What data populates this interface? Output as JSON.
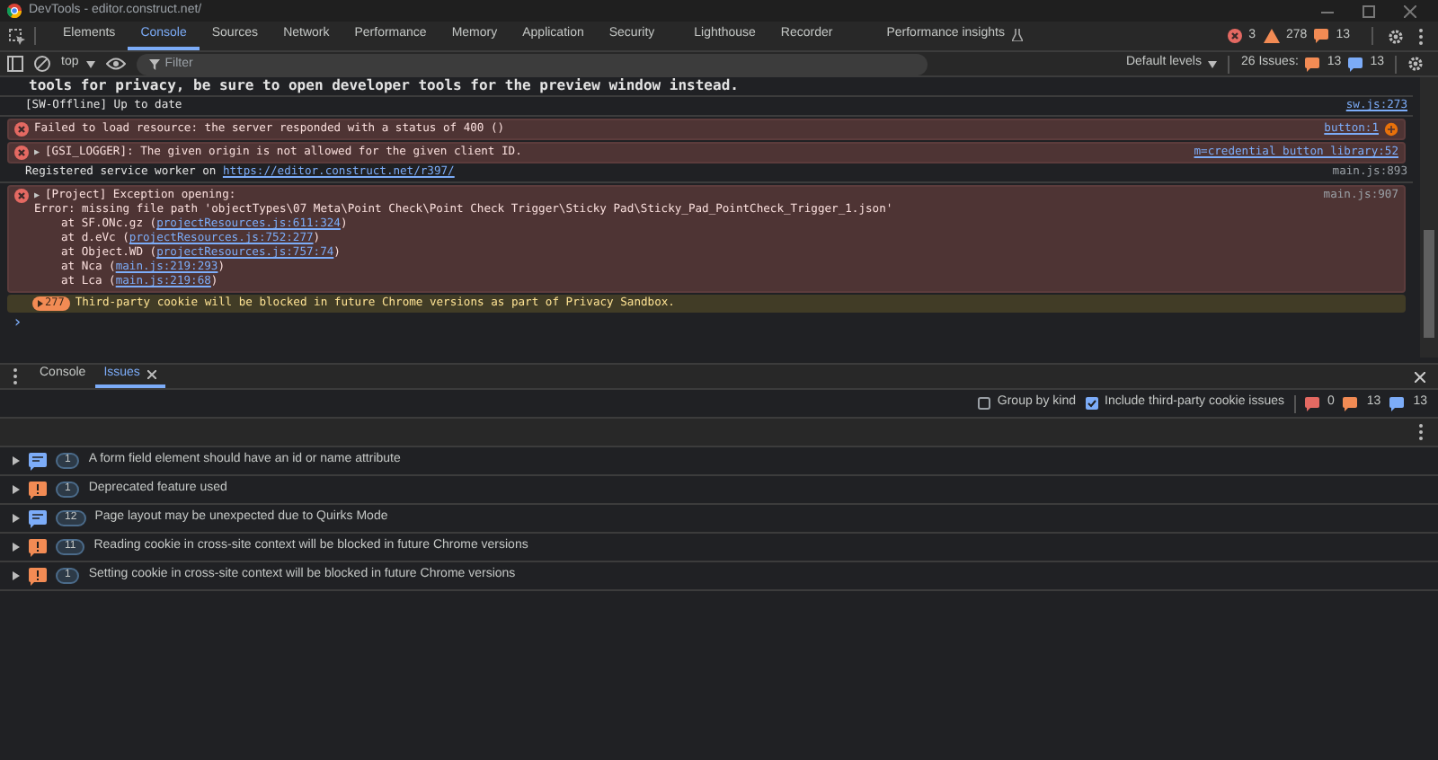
{
  "window": {
    "title": "DevTools - editor.construct.net/"
  },
  "tabs": [
    {
      "label": "Elements",
      "selected": false
    },
    {
      "label": "Console",
      "selected": true
    },
    {
      "label": "Sources",
      "selected": false
    },
    {
      "label": "Network",
      "selected": false
    },
    {
      "label": "Performance",
      "selected": false
    },
    {
      "label": "Memory",
      "selected": false
    },
    {
      "label": "Application",
      "selected": false
    },
    {
      "label": "Security",
      "selected": false
    },
    {
      "label": "Lighthouse",
      "selected": false
    },
    {
      "label": "Recorder",
      "selected": false
    },
    {
      "label": "Performance insights",
      "selected": false
    }
  ],
  "counters": {
    "errors": "3",
    "warnings": "278",
    "issues": "13"
  },
  "toolbar": {
    "context": "top",
    "filter_placeholder": "Filter",
    "levels": "Default levels",
    "issues_label": "26 Issues:",
    "issues_warning": "13",
    "issues_info": "13"
  },
  "console": {
    "clipped_line": "tools for privacy, be sure to open developer tools for the preview window instead.",
    "messages": [
      {
        "kind": "info",
        "text": "[SW-Offline] Up to date",
        "source": "sw.js:273",
        "source_link": true
      },
      {
        "kind": "error",
        "text": "Failed to load resource: the server responded with a status of 400 ()",
        "source": "button:1",
        "source_link": true
      },
      {
        "kind": "error",
        "toggle": "▶",
        "text": "[GSI_LOGGER]: The given origin is not allowed for the given client ID.",
        "source": "m=credential_button_library:52",
        "source_link": true
      },
      {
        "kind": "info",
        "text": "Registered service worker on ",
        "link": "https://editor.construct.net/r397/",
        "source": "main.js:893",
        "source_link": false
      },
      {
        "kind": "error",
        "toggle": "▶",
        "text": "[Project] Exception opening:",
        "source": "main.js:907",
        "source_link": false,
        "detail": "Error: missing file path 'objectTypes\\07 Meta\\Point Check\\Point Check Trigger\\Sticky Pad\\Sticky_Pad_PointCheck_Trigger_1.json'",
        "stack": [
          {
            "prefix": "at SF.ONc.gz (",
            "link": "projectResources.js:611:324",
            "suffix": ")"
          },
          {
            "prefix": "at d.eVc (",
            "link": "projectResources.js:752:277",
            "suffix": ")"
          },
          {
            "prefix": "at Object.WD (",
            "link": "projectResources.js:757:74",
            "suffix": ")"
          },
          {
            "prefix": "at Nca (",
            "link": "main.js:219:293",
            "suffix": ")"
          },
          {
            "prefix": "at Lca (",
            "link": "main.js:219:68",
            "suffix": ")"
          }
        ]
      },
      {
        "kind": "warning",
        "badge": "277",
        "text": "Third-party cookie will be blocked in future Chrome versions as part of Privacy Sandbox."
      }
    ],
    "prompt": "›"
  },
  "drawer": {
    "tabs": [
      {
        "label": "Console",
        "selected": false
      },
      {
        "label": "Issues",
        "selected": true
      }
    ],
    "group_by_kind": {
      "label": "Group by kind",
      "checked": false
    },
    "third_party": {
      "label": "Include third-party cookie issues",
      "checked": true
    },
    "counts": {
      "errors": "0",
      "warnings": "13",
      "info": "13"
    },
    "issues": [
      {
        "kind": "info",
        "count": "1",
        "text": "A form field element should have an id or name attribute"
      },
      {
        "kind": "warning",
        "count": "1",
        "text": "Deprecated feature used"
      },
      {
        "kind": "info",
        "count": "12",
        "text": "Page layout may be unexpected due to Quirks Mode"
      },
      {
        "kind": "warning",
        "count": "11",
        "text": "Reading cookie in cross-site context will be blocked in future Chrome versions"
      },
      {
        "kind": "warning",
        "count": "1",
        "text": "Setting cookie in cross-site context will be blocked in future Chrome versions"
      }
    ]
  }
}
